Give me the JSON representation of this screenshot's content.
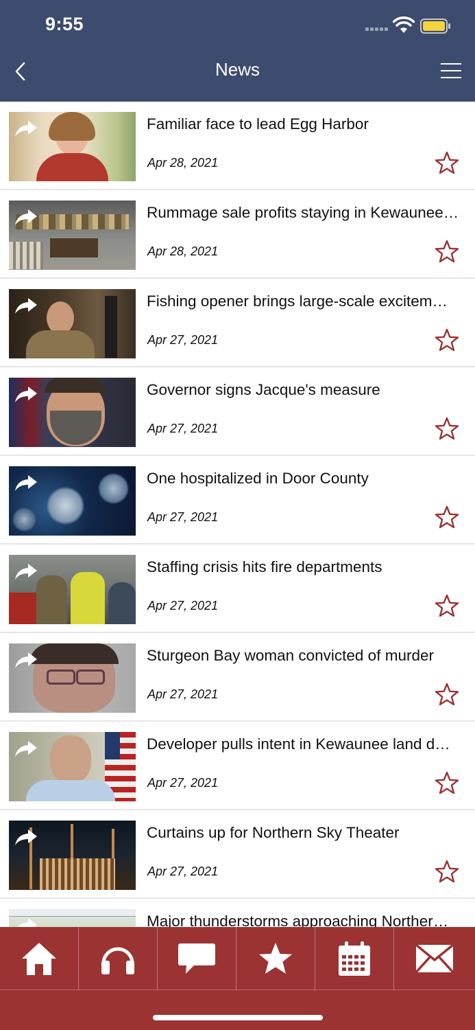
{
  "status": {
    "time": "9:55"
  },
  "nav": {
    "title": "News"
  },
  "articles": [
    {
      "title": "Familiar face to lead Egg Harbor",
      "date": "Apr 28, 2021"
    },
    {
      "title": "Rummage sale profits staying in Kewaunee…",
      "date": "Apr 28, 2021"
    },
    {
      "title": "Fishing opener brings large-scale excitem…",
      "date": "Apr 27, 2021"
    },
    {
      "title": "Governor signs Jacque's measure",
      "date": "Apr 27, 2021"
    },
    {
      "title": "One hospitalized in Door County",
      "date": "Apr 27, 2021"
    },
    {
      "title": "Staffing crisis hits fire departments",
      "date": "Apr 27, 2021"
    },
    {
      "title": "Sturgeon Bay woman convicted of murder",
      "date": "Apr 27, 2021"
    },
    {
      "title": "Developer pulls intent in Kewaunee land d…",
      "date": "Apr 27, 2021"
    },
    {
      "title": "Curtains up for Northern Sky Theater",
      "date": "Apr 27, 2021"
    },
    {
      "title": "Major thunderstorms approaching Norther…",
      "date": ""
    }
  ],
  "tabs": [
    {
      "icon": "home-icon"
    },
    {
      "icon": "headphones-icon"
    },
    {
      "icon": "chat-icon"
    },
    {
      "icon": "star-icon"
    },
    {
      "icon": "calendar-icon"
    },
    {
      "icon": "mail-icon"
    }
  ],
  "colors": {
    "header": "#3d4b6e",
    "accent": "#9b3333",
    "star": "#9b3333"
  }
}
